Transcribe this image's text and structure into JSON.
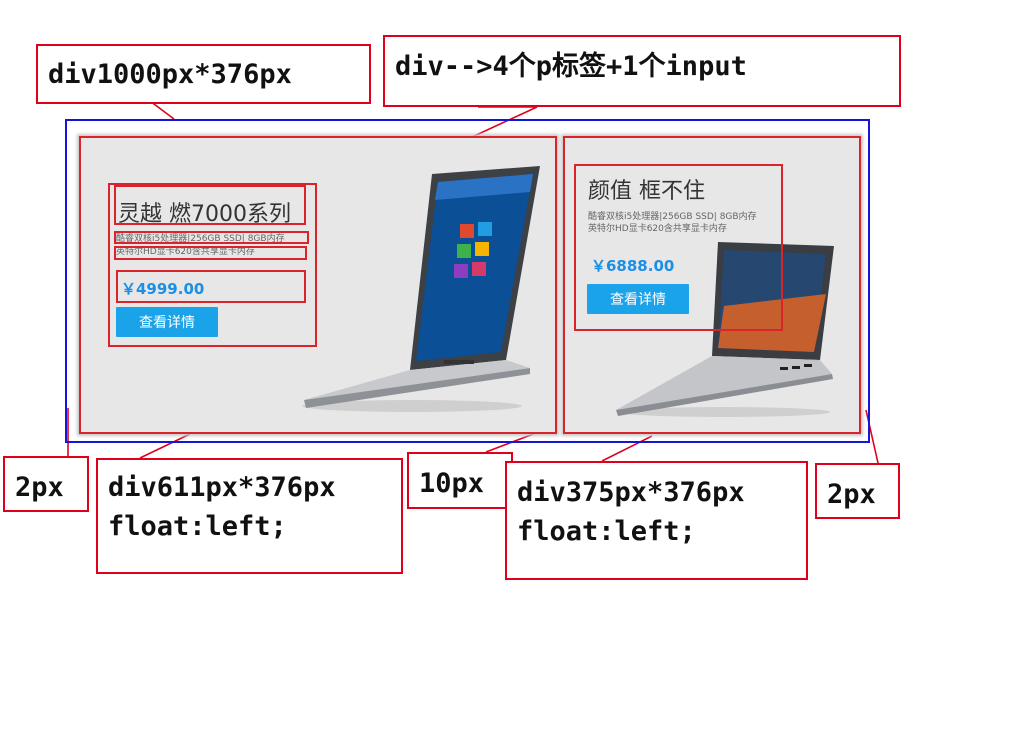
{
  "callouts": {
    "outer_div": "div1000px*376px",
    "inner_div": "div-->4个p标签+1个input",
    "left_gap": "2px",
    "left_div_size": "div611px*376px",
    "left_div_float": "float:left;",
    "middle_gap": "10px",
    "right_div_size": "div375px*376px",
    "right_div_float": "float:left;",
    "right_gap": "2px"
  },
  "left_product": {
    "title": "灵越 燃7000系列",
    "spec_line1": "酷睿双核i5处理器|256GB SSD| 8GB内存",
    "spec_line2": "英特尔HD显卡620含共享显卡内存",
    "price": "￥4999.00",
    "button": "查看详情"
  },
  "right_product": {
    "title": "颜值 框不住",
    "spec_line1": "酷睿双核i5处理器|256GB SSD| 8GB内存",
    "spec_line2": "英特尔HD显卡620含共享显卡内存",
    "price": "￥6888.00",
    "button": "查看详情"
  },
  "colors": {
    "annotation_red": "#e0001b",
    "outer_border_blue": "#1515d8",
    "card_background": "#e7e7e7",
    "button_blue": "#1ba3ea",
    "price_blue": "#1a8fe6"
  }
}
